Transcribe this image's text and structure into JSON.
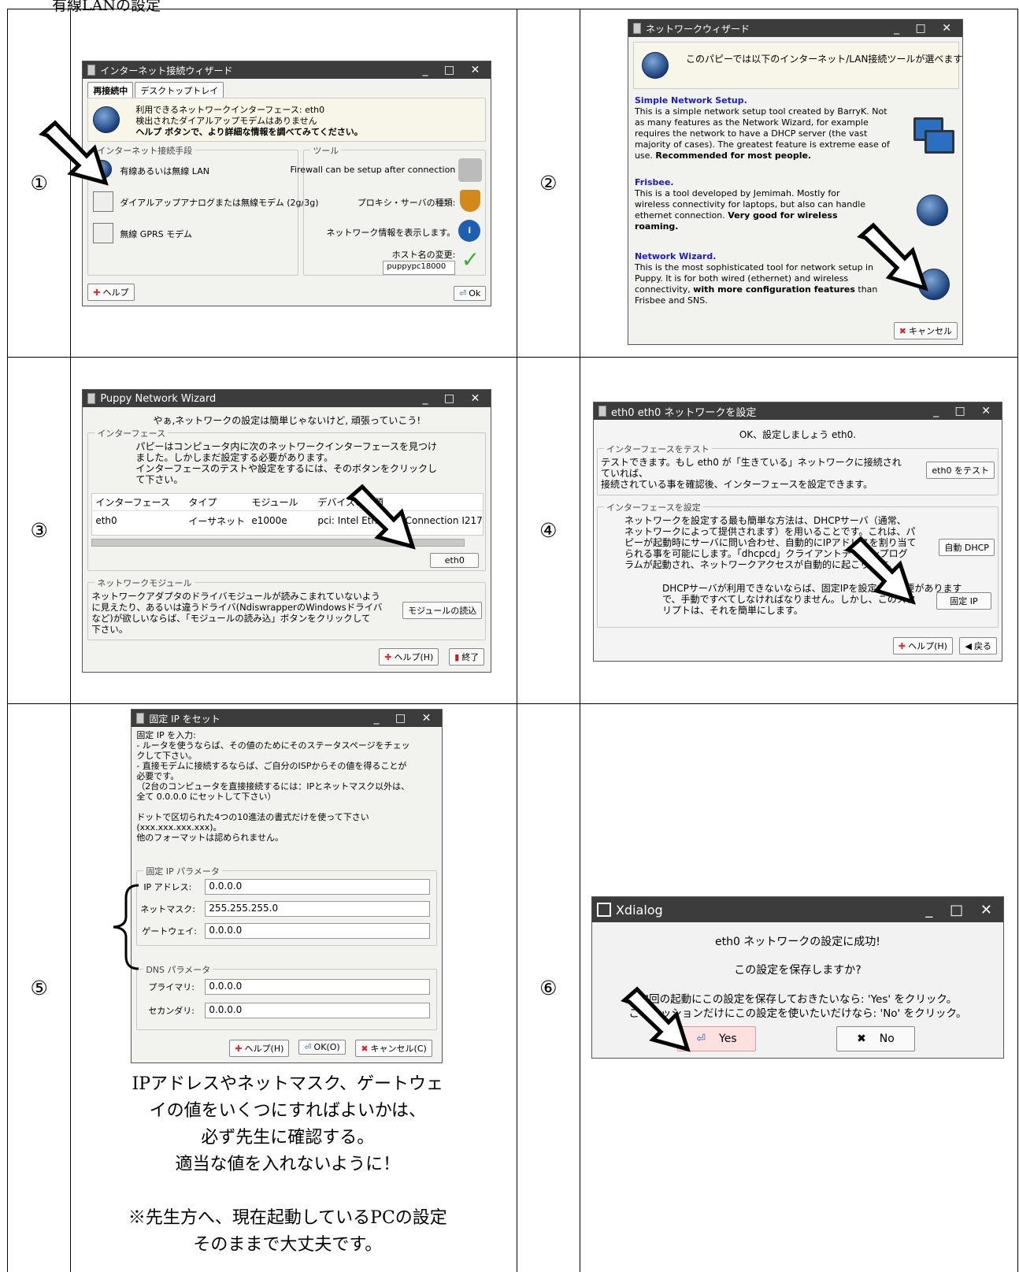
{
  "page": {
    "heading": "有線LANの設定"
  },
  "steps": [
    "①",
    "②",
    "③",
    "④",
    "⑤",
    "⑥"
  ],
  "step1": {
    "title": "インターネット接続ウィザード",
    "tabs": [
      "再接続中",
      "デスクトップトレイ"
    ],
    "info_lines": [
      "利用できるネットワークインターフェース: eth0",
      "検出されたダイアルアップモデムはありません",
      "ヘルプ ボタンで、より詳細な情報を調べてみてください。"
    ],
    "group_connect": "インターネット接続手段",
    "options": [
      "有線あるいは無線 LAN",
      "ダイアルアップアナログまたは無線モデム (2g/3g)",
      "無線 GPRS モデム"
    ],
    "group_tools": "ツール",
    "tools": [
      "Firewall can be setup after connection",
      "プロキシ・サーバの種類:",
      "ネットワーク情報を表示します。",
      "ホスト名の変更:"
    ],
    "hostname": "puppypc18000",
    "help_btn": "ヘルプ",
    "ok_btn": "Ok"
  },
  "step2": {
    "title": "ネットワークウィザード",
    "intro": "このパピーでは以下のインターネット/LAN接続ツールが選べます",
    "tools": [
      {
        "name": "Simple Network Setup",
        "lines": [
          "This is a simple network setup tool created by BarryK. Not",
          "as many features as the Network Wizard, for example",
          "requires the network to have a DHCP server (the vast",
          "majority of cases). The greatest feature is extreme ease of"
        ],
        "last": "use. ",
        "bold": "Recommended for most people."
      },
      {
        "name": "Frisbee",
        "lines": [
          "This is a tool developed by Jemimah. Mostly for",
          "wireless connectivity for laptops, but also can handle"
        ],
        "last": "ethernet connection. ",
        "bold": "Very good for wireless",
        "bold2": "roaming."
      },
      {
        "name": "Network Wizard",
        "lines": [
          "This is the most sophisticated tool for network setup in",
          "Puppy. It is for both wired (ethernet) and wireless"
        ],
        "last": "connectivity, ",
        "bold": "with more configuration features",
        "after": " than",
        "tail": "Frisbee and SNS."
      }
    ],
    "cancel_btn": "キャンセル"
  },
  "step3": {
    "title": "Puppy Network Wizard",
    "header": "やぁ,ネットワークの設定は簡単じゃないけど, 頑張っていこう!",
    "group_if": "インターフェース",
    "desc": [
      "パピーはコンピュータ内に次のネットワークインターフェースを見つけ",
      "ました。しかしまだ設定する必要があります。",
      "インターフェースのテストや設定をするには、そのボタンをクリックし",
      "て下さい。"
    ],
    "columns": [
      "インターフェース",
      "タイプ",
      "モジュール",
      "デバイスの種類"
    ],
    "row": [
      "eth0",
      "イーサネット",
      "e1000e",
      "pci: Intel Ethernet Connection I217"
    ],
    "eth_btn": "eth0",
    "group_mod": "ネットワークモジュール",
    "mod_desc": [
      "ネットワークアダプタのドライバモジュールが読みこまれていないよう",
      "に見えたり、あるいは違うドライバ(NdiswrapperのWindowsドライバ",
      "など)が欲しいならば、「モジュールの読み込」ボタンをクリックして",
      "下さい。"
    ],
    "mod_btn": "モジュールの読込",
    "help_btn": "ヘルプ(H)",
    "quit_btn": "終了"
  },
  "step4": {
    "title": "eth0 eth0 ネットワークを設定",
    "header": "OK、設定しましょう eth0.",
    "group_test": "インターフェースをテスト",
    "test_desc": [
      "テストできます。もし eth0 が「生きている」ネットワークに接続され",
      "ていれば、",
      "接続されている事を確認後、インターフェースを設定できます。"
    ],
    "test_btn": "eth0 をテスト",
    "group_set": "インターフェースを設定",
    "set_desc": [
      "ネットワークを設定する最も簡単な方法は、DHCPサーバ（通常、",
      "ネットワークによって提供されます）を用いることです。これは、パ",
      "ピーが起動時にサーバに問い合わせ、自動的にIPアドレスを割り当て",
      "られる事を可能にします。「dhcpcd」クライアントデーモンプログ",
      "ラムが起動され、ネットワークアクセスが自動的に起こります。"
    ],
    "dhcp_btn": "自動 DHCP",
    "static_desc": [
      "DHCPサーバが利用できないならば、固定IPを設定する必要があります",
      "で、手動ですべてしなければなりません。しかし、このスク",
      "リプトは、それを簡単にします。"
    ],
    "static_btn": "固定 IP",
    "help_btn": "ヘルプ(H)",
    "back_btn": "戻る"
  },
  "step5": {
    "title": "固定 IP をセット",
    "desc": [
      "固定 IP を入力:",
      "- ルータを使うならば、その値のためにそのステータスページをチェッ",
      "クして下さい。",
      "- 直接モデムに接続するならば、ご自分のISPからその値を得ることが",
      "必要です。",
      "（2台のコンピュータを直接接続するには：IPとネットマスク以外は、",
      "全て 0.0.0.0 にセットして下さい）",
      "",
      "ドットで区切られた4つの10進法の書式だけを使って下さい",
      "(xxx.xxx.xxx.xxx)。",
      "他のフォーマットは認められません。"
    ],
    "group_ip": "固定 IP パラメータ",
    "ip_label": "IP アドレス:",
    "ip_value": "0.0.0.0",
    "mask_label": "ネットマスク:",
    "mask_value": "255.255.255.0",
    "gw_label": "ゲートウェイ:",
    "gw_value": "0.0.0.0",
    "group_dns": "DNS パラメータ",
    "dns1_label": "プライマリ:",
    "dns1_value": "0.0.0.0",
    "dns2_label": "セカンダリ:",
    "dns2_value": "0.0.0.0",
    "help_btn": "ヘルプ(H)",
    "ok_btn": "OK(O)",
    "cancel_btn": "キャンセル(C)",
    "note": [
      "IPアドレスやネットマスク、ゲートウェ",
      "イの値をいくつにすればよいかは、",
      "必ず先生に確認する。",
      "適当な値を入れないように！",
      "",
      "※先生方へ、現在起動しているPCの設定",
      "そのままで大丈夫です。"
    ]
  },
  "step6": {
    "title": "Xdialog",
    "line1": "eth0 ネットワークの設定に成功!",
    "line2": "この設定を保存しますか?",
    "line3": "次回の起動にこの設定を保存しておきたいなら: 'Yes' をクリック。",
    "line4": "このセッションだけにこの設定を使いたいだけなら: 'No' をクリック。",
    "yes_btn": "Yes",
    "no_btn": "No"
  }
}
